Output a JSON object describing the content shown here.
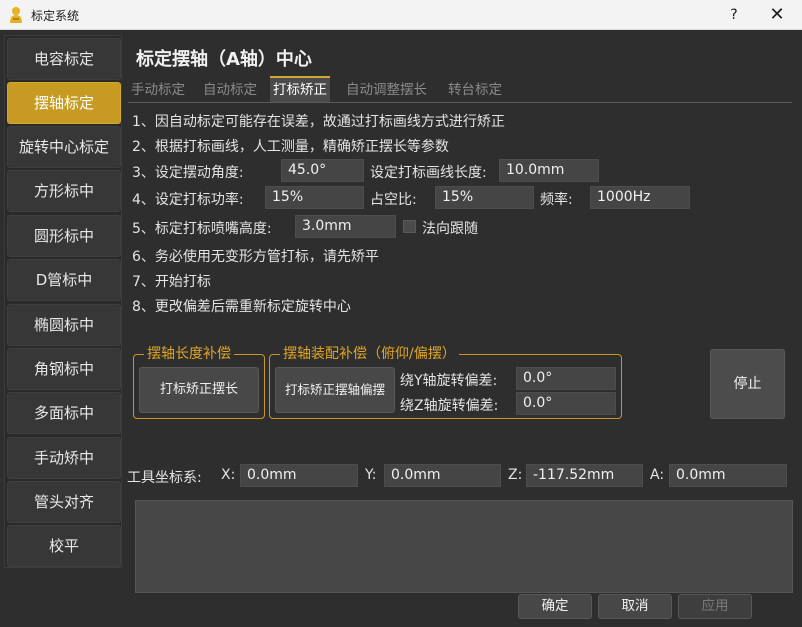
{
  "window": {
    "title": "标定系统",
    "help_label": "?",
    "close_label": "✕"
  },
  "sidebar": {
    "items": [
      {
        "label": "电容标定",
        "active": false
      },
      {
        "label": "摆轴标定",
        "active": true
      },
      {
        "label": "旋转中心标定",
        "active": false
      },
      {
        "label": "方形标中",
        "active": false
      },
      {
        "label": "圆形标中",
        "active": false
      },
      {
        "label": "D管标中",
        "active": false
      },
      {
        "label": "椭圆标中",
        "active": false
      },
      {
        "label": "角钢标中",
        "active": false
      },
      {
        "label": "多面标中",
        "active": false
      },
      {
        "label": "手动矫中",
        "active": false
      },
      {
        "label": "管头对齐",
        "active": false
      },
      {
        "label": "校平",
        "active": false
      }
    ]
  },
  "main": {
    "title": "标定摆轴（A轴）中心",
    "tabs": [
      {
        "label": "手动标定",
        "active": false
      },
      {
        "label": "自动标定",
        "active": false
      },
      {
        "label": "打标矫正",
        "active": true
      },
      {
        "label": "自动调整摆长",
        "active": false
      },
      {
        "label": "转台标定",
        "active": false
      }
    ],
    "steps": {
      "s1": "1、因自动标定可能存在误差，故通过打标画线方式进行矫正",
      "s2": "2、根据打标画线，人工测量，精确矫正摆长等参数",
      "s3_label": "3、设定摆动角度:",
      "s3_value": "45.0°",
      "s3b_label": "设定打标画线长度:",
      "s3b_value": "10.0mm",
      "s4_label": "4、设定打标功率:",
      "s4_value": "15%",
      "s4b_label": "占空比:",
      "s4b_value": "15%",
      "s4c_label": "频率:",
      "s4c_value": "1000Hz",
      "s5_label": "5、标定打标喷嘴高度:",
      "s5_value": "3.0mm",
      "s5_check_label": "法向跟随",
      "s6": "6、务必使用无变形方管打标，请先矫平",
      "s7": "7、开始打标",
      "s8": "8、更改偏差后需重新标定旋转中心"
    },
    "group_length": {
      "title": "摆轴长度补偿",
      "button": "打标矫正摆长"
    },
    "group_assembly": {
      "title": "摆轴装配补偿（俯仰/偏摆）",
      "button": "打标矫正摆轴偏摆",
      "y_label": "绕Y轴旋转偏差:",
      "y_value": "0.0°",
      "z_label": "绕Z轴旋转偏差:",
      "z_value": "0.0°"
    },
    "stop_button": "停止",
    "tool_coord": {
      "label": "工具坐标系:",
      "x_label": "X:",
      "x_value": "0.0mm",
      "y_label": "Y:",
      "y_value": "0.0mm",
      "z_label": "Z:",
      "z_value": "-117.52mm",
      "a_label": "A:",
      "a_value": "0.0mm"
    }
  },
  "footer": {
    "ok": "确定",
    "cancel": "取消",
    "apply": "应用"
  },
  "colors": {
    "accent": "#c79a22",
    "background": "#2e2e2e",
    "field": "#454545"
  }
}
